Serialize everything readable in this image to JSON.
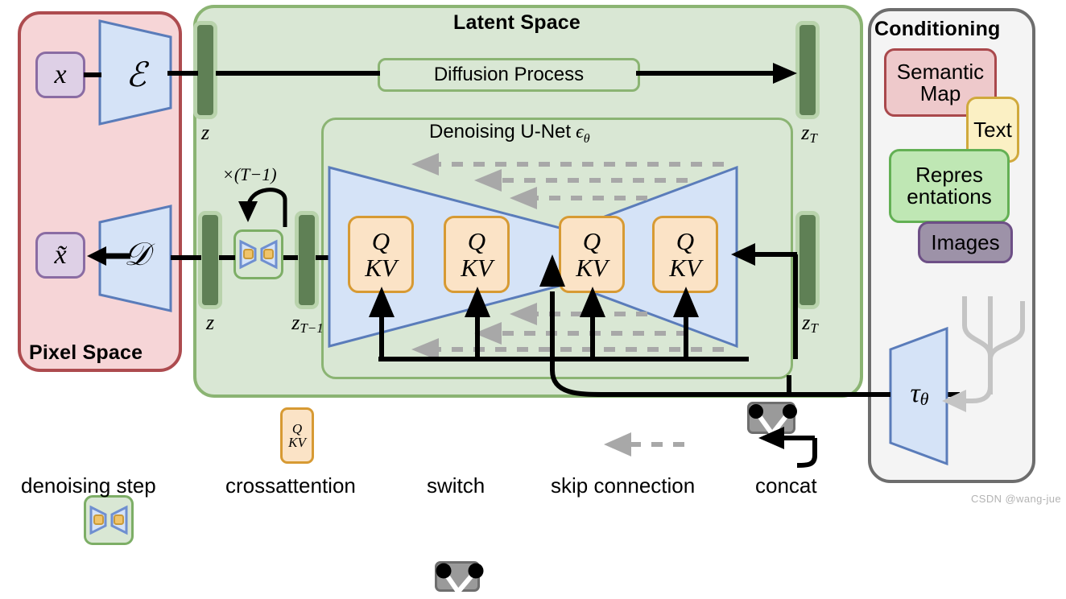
{
  "panels": {
    "pixel_space": {
      "title": "Pixel Space",
      "color": "#f6d5d7",
      "border": "#ad4b4f"
    },
    "latent_space": {
      "title": "Latent Space",
      "color": "#d9e7d4",
      "border": "#8bb473"
    },
    "conditioning": {
      "title": "Conditioning",
      "color": "#f4f4f4",
      "border": "#6d6d6d"
    },
    "unet": {
      "title": "Denoising U-Net ϵθ",
      "title_main": "Denoising U-Net",
      "title_sym": "ϵ",
      "title_sub": "θ"
    },
    "diffusion": {
      "label": "Diffusion Process"
    }
  },
  "pixel": {
    "input_label": "x",
    "output_label": "x̃",
    "encoder_label": "ℰ",
    "decoder_label": "𝒟"
  },
  "latent": {
    "z_top_label": "z",
    "zT_top_label": "z_T",
    "zT_top_main": "z",
    "zT_top_sub": "T",
    "z_bottom_label": "z",
    "zTm1_main": "z",
    "zTm1_sub": "T−1",
    "zT_bottom_main": "z",
    "zT_bottom_sub": "T",
    "loop_label": "×(T−1)",
    "loop_label_mul": "×(",
    "loop_label_T": "T",
    "loop_label_rest": "−1)"
  },
  "crossattention_blocks": [
    {
      "q": "Q",
      "kv": "KV"
    },
    {
      "q": "Q",
      "kv": "KV"
    },
    {
      "q": "Q",
      "kv": "KV"
    },
    {
      "q": "Q",
      "kv": "KV"
    }
  ],
  "conditioning_chips": [
    {
      "label": "Semantic Map",
      "name": "semantic-map",
      "color": "#eec9cb",
      "border": "#a9484c"
    },
    {
      "label": "Text",
      "name": "text",
      "color": "#fbf0c4",
      "border": "#d0a93c"
    },
    {
      "label": "Repres entations",
      "line1": "Repres",
      "line2": "entations",
      "name": "representations",
      "color": "#bfe7b4",
      "border": "#63b054"
    },
    {
      "label": "Images",
      "name": "images",
      "color": "#9d92a8",
      "border": "#6d4f86"
    }
  ],
  "conditioning_encoder": {
    "label": "τθ",
    "main": "τ",
    "sub": "θ"
  },
  "legend": [
    {
      "name": "denoising-step",
      "label": "denoising step"
    },
    {
      "name": "crossattention",
      "label": "crossattention",
      "q": "Q",
      "kv": "KV"
    },
    {
      "name": "switch",
      "label": "switch"
    },
    {
      "name": "skip-connection",
      "label": "skip connection"
    },
    {
      "name": "concat",
      "label": "concat"
    }
  ],
  "watermark": {
    "text": "CSDN @wang-jue"
  },
  "colors": {
    "pink_fill": "#f6d5d7",
    "pink_border": "#ad4b4f",
    "green_fill": "#d9e7d4",
    "green_border": "#8bb473",
    "dark_green_bar": "#5f8055",
    "blue_fill": "#d5e3f7",
    "blue_border": "#5a7cba",
    "orange_fill": "#fbe3c6",
    "orange_border": "#d79a33",
    "purple_fill": "#ded0e6",
    "purple_border": "#8a6ca3",
    "gray_skip": "#a8a8a8",
    "gray_border": "#6d6d6d"
  }
}
